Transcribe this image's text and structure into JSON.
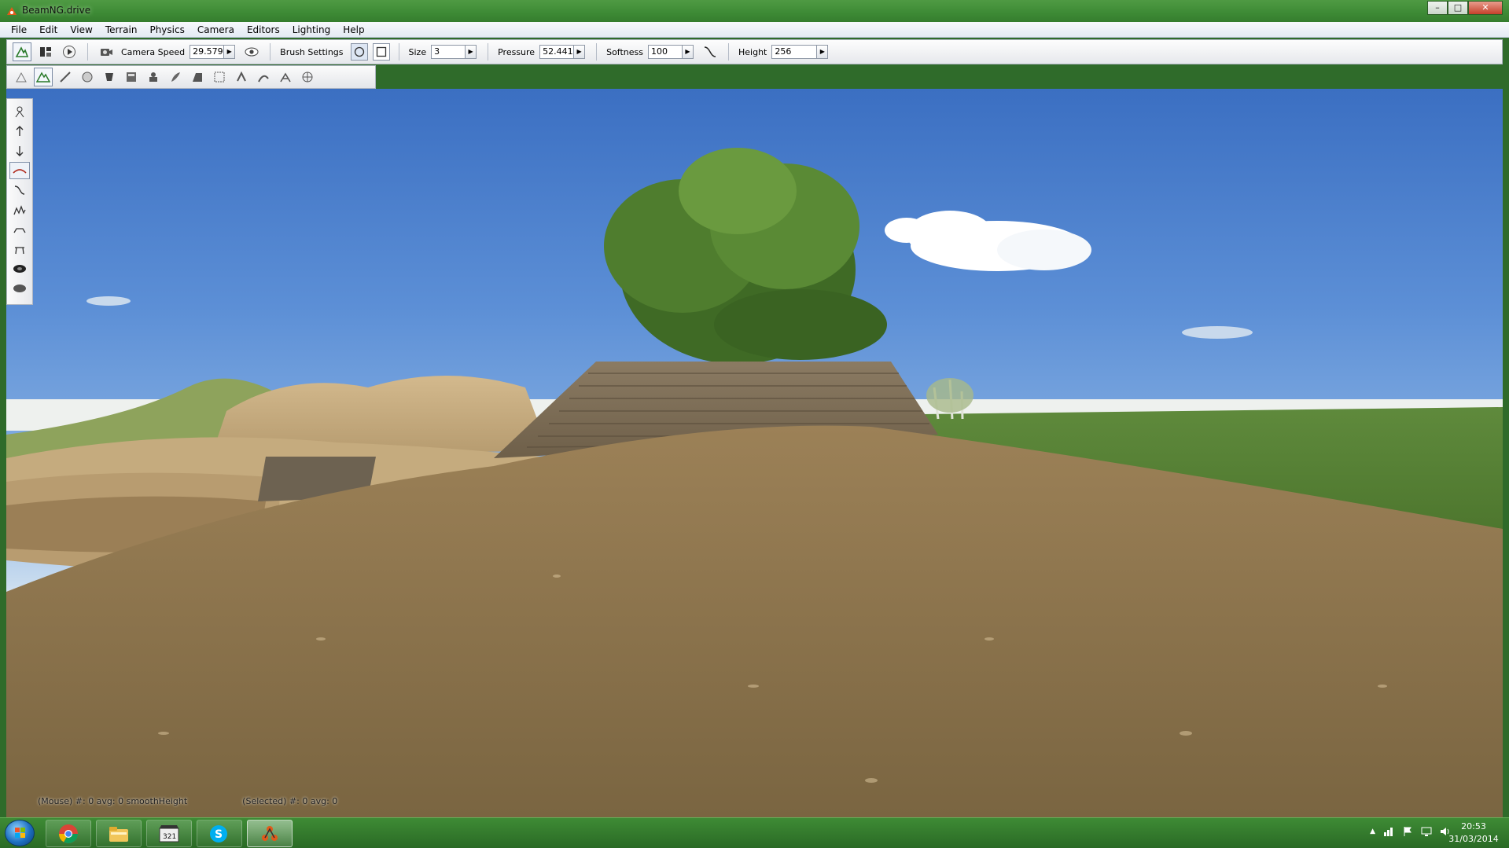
{
  "window": {
    "title": "BeamNG.drive",
    "buttons": [
      "minimize",
      "maximize",
      "close"
    ]
  },
  "menu": [
    "File",
    "Edit",
    "View",
    "Terrain",
    "Physics",
    "Camera",
    "Editors",
    "Lighting",
    "Help"
  ],
  "toolbar": {
    "camera_speed_label": "Camera Speed",
    "camera_speed_value": "29.579",
    "brush_settings_label": "Brush Settings",
    "size_label": "Size",
    "size_value": "3",
    "pressure_label": "Pressure",
    "pressure_value": "52.441",
    "softness_label": "Softness",
    "softness_value": "100",
    "height_label": "Height",
    "height_value": "256"
  },
  "status": {
    "mouse": "(Mouse) #: 0  avg: 0  smoothHeight",
    "selected": "(Selected) #: 0  avg: 0"
  },
  "taskbar": {
    "apps": [
      "chrome-icon",
      "explorer-icon",
      "media-player-icon",
      "skype-icon",
      "beamng-icon"
    ],
    "time": "20:53",
    "date": "31/03/2014"
  },
  "colors": {
    "titlebar": "#3d8a35",
    "taskbar": "#2a6a25",
    "accent": "#1d6fc0"
  }
}
